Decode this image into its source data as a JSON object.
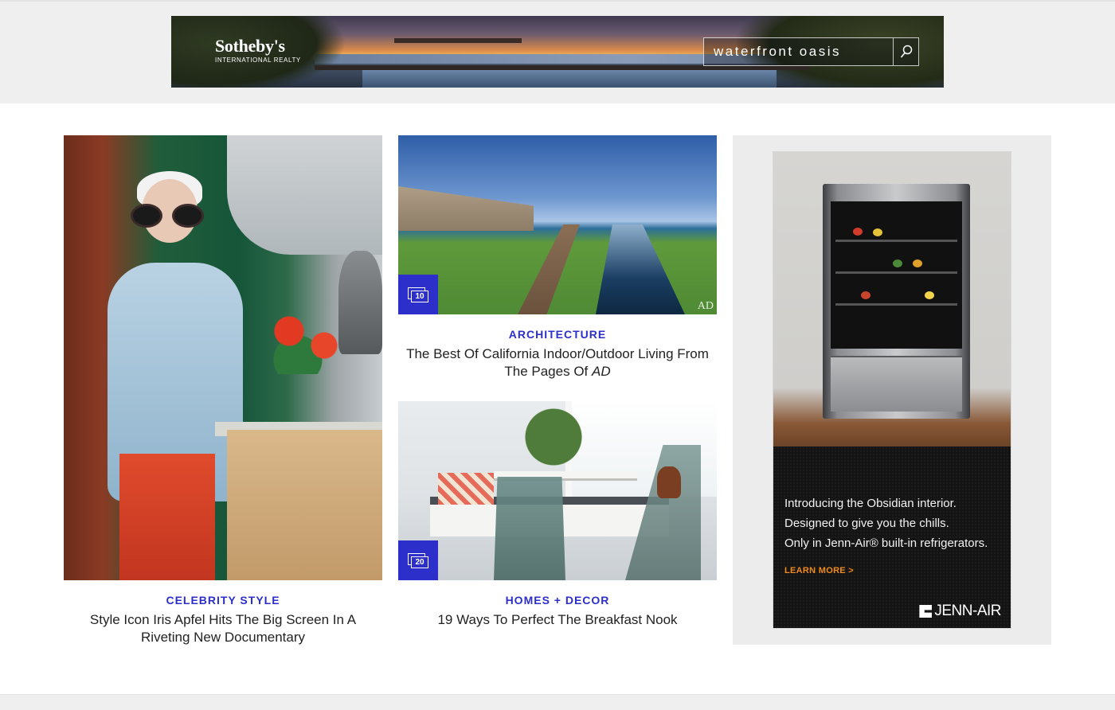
{
  "top_ad": {
    "brand_name": "Sotheby's",
    "brand_sub": "INTERNATIONAL REALTY",
    "search_placeholder": "waterfront oasis"
  },
  "cards": [
    {
      "category": "CELEBRITY STYLE",
      "title": "Style Icon Iris Apfel Hits The Big Screen In A Riveting New Documentary"
    },
    {
      "category": "ARCHITECTURE",
      "title_prefix": "The Best Of California Indoor/Outdoor Living From The Pages Of ",
      "title_emphasis": "AD",
      "gallery_count": "10",
      "watermark": "AD"
    },
    {
      "category": "HOMES + DECOR",
      "title": "19 Ways To Perfect The Breakfast Nook",
      "gallery_count": "20"
    }
  ],
  "side_ad": {
    "line1": "Introducing the Obsidian interior.",
    "line2": "Designed to give you the chills.",
    "line3": "Only in Jenn-Air® built-in refrigerators.",
    "cta": "LEARN MORE >",
    "logo": "JENN-AIR"
  },
  "colors": {
    "accent_blue": "#2c2fc9",
    "ad_cta_orange": "#f08a1a"
  }
}
